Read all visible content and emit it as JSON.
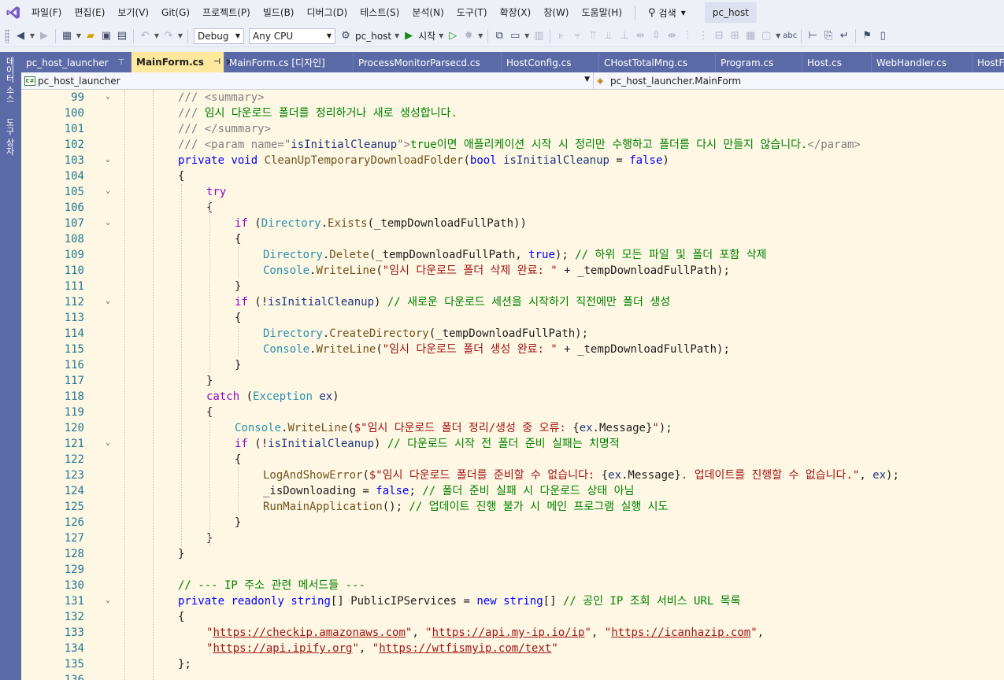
{
  "menubar": {
    "items": [
      "파일(F)",
      "편집(E)",
      "보기(V)",
      "Git(G)",
      "프로젝트(P)",
      "빌드(B)",
      "디버그(D)",
      "테스트(S)",
      "분석(N)",
      "도구(T)",
      "확장(X)",
      "창(W)",
      "도움말(H)"
    ],
    "search_label": "검색",
    "project_name": "pc_host"
  },
  "toolbar": {
    "config": "Debug",
    "platform": "Any CPU",
    "startup_project": "pc_host",
    "start_label": "시작"
  },
  "sidebar": {
    "tab1": "데이터 소스",
    "tab2": "도구 상자"
  },
  "tabs": [
    {
      "label": "pc_host_launcher",
      "pinned": true,
      "active": false
    },
    {
      "label": "MainForm.cs",
      "pinned": true,
      "active": true
    },
    {
      "label": "MainForm.cs [디자인]",
      "active": false
    },
    {
      "label": "ProcessMonitorParsecd.cs",
      "active": false
    },
    {
      "label": "HostConfig.cs",
      "active": false
    },
    {
      "label": "CHostTotalMng.cs",
      "active": false
    },
    {
      "label": "Program.cs",
      "active": false
    },
    {
      "label": "Host.cs",
      "active": false
    },
    {
      "label": "WebHandler.cs",
      "active": false
    },
    {
      "label": "HostF",
      "active": false
    }
  ],
  "navbar": {
    "project": "pc_host_launcher",
    "type": "pc_host_launcher.MainForm"
  },
  "code": {
    "first_line": 99,
    "lines": [
      {
        "n": "99",
        "fold": true,
        "indent": 2,
        "tokens": [
          [
            "xd",
            "/// <summary>"
          ]
        ]
      },
      {
        "n": "100",
        "indent": 2,
        "tokens": [
          [
            "xd",
            "/// "
          ],
          [
            "cm",
            "임시 다운로드 폴더를 정리하거나 새로 생성합니다."
          ]
        ]
      },
      {
        "n": "101",
        "indent": 2,
        "tokens": [
          [
            "xd",
            "/// </summary>"
          ]
        ]
      },
      {
        "n": "102",
        "indent": 2,
        "tokens": [
          [
            "xd",
            "/// <param name=\""
          ],
          [
            "pm",
            "isInitialCleanup"
          ],
          [
            "xd",
            "\">"
          ],
          [
            "cm",
            "true이면 애플리케이션 시작 시 정리만 수행하고 폴더를 다시 만들지 않습니다."
          ],
          [
            "xd",
            "</param>"
          ]
        ]
      },
      {
        "n": "103",
        "fold": true,
        "indent": 2,
        "tokens": [
          [
            "kw",
            "private"
          ],
          [
            "fd",
            " "
          ],
          [
            "kw",
            "void"
          ],
          [
            "fd",
            " "
          ],
          [
            "mt",
            "CleanUpTemporaryDownloadFolder"
          ],
          [
            "fd",
            "("
          ],
          [
            "kw",
            "bool"
          ],
          [
            "fd",
            " "
          ],
          [
            "pm",
            "isInitialCleanup"
          ],
          [
            "fd",
            " = "
          ],
          [
            "kw",
            "false"
          ],
          [
            "fd",
            ")"
          ]
        ]
      },
      {
        "n": "104",
        "indent": 2,
        "tokens": [
          [
            "fd",
            "{"
          ]
        ]
      },
      {
        "n": "105",
        "fold": true,
        "indent": 3,
        "tokens": [
          [
            "ctl",
            "try"
          ]
        ]
      },
      {
        "n": "106",
        "indent": 3,
        "tokens": [
          [
            "fd",
            "{"
          ]
        ]
      },
      {
        "n": "107",
        "fold": true,
        "indent": 4,
        "tokens": [
          [
            "ctl",
            "if"
          ],
          [
            "fd",
            " ("
          ],
          [
            "ty",
            "Directory"
          ],
          [
            "fd",
            "."
          ],
          [
            "mt",
            "Exists"
          ],
          [
            "fd",
            "(_tempDownloadFullPath))"
          ]
        ]
      },
      {
        "n": "108",
        "indent": 4,
        "tokens": [
          [
            "fd",
            "{"
          ]
        ]
      },
      {
        "n": "109",
        "indent": 5,
        "tokens": [
          [
            "ty",
            "Directory"
          ],
          [
            "fd",
            "."
          ],
          [
            "mt",
            "Delete"
          ],
          [
            "fd",
            "(_tempDownloadFullPath, "
          ],
          [
            "kw",
            "true"
          ],
          [
            "fd",
            "); "
          ],
          [
            "cm",
            "// 하위 모든 파일 및 폴더 포함 삭제"
          ]
        ]
      },
      {
        "n": "110",
        "indent": 5,
        "tokens": [
          [
            "ty",
            "Console"
          ],
          [
            "fd",
            "."
          ],
          [
            "mt",
            "WriteLine"
          ],
          [
            "fd",
            "("
          ],
          [
            "st",
            "\"임시 다운로드 폴더 삭제 완료: \""
          ],
          [
            "fd",
            " + _tempDownloadFullPath);"
          ]
        ]
      },
      {
        "n": "111",
        "indent": 4,
        "tokens": [
          [
            "fd",
            "}"
          ]
        ]
      },
      {
        "n": "112",
        "fold": true,
        "indent": 4,
        "tokens": [
          [
            "ctl",
            "if"
          ],
          [
            "fd",
            " (!"
          ],
          [
            "pm",
            "isInitialCleanup"
          ],
          [
            "fd",
            ") "
          ],
          [
            "cm",
            "// 새로운 다운로드 세션을 시작하기 직전에만 폴더 생성"
          ]
        ]
      },
      {
        "n": "113",
        "indent": 4,
        "tokens": [
          [
            "fd",
            "{"
          ]
        ]
      },
      {
        "n": "114",
        "indent": 5,
        "tokens": [
          [
            "ty",
            "Directory"
          ],
          [
            "fd",
            "."
          ],
          [
            "mt",
            "CreateDirectory"
          ],
          [
            "fd",
            "(_tempDownloadFullPath);"
          ]
        ]
      },
      {
        "n": "115",
        "indent": 5,
        "tokens": [
          [
            "ty",
            "Console"
          ],
          [
            "fd",
            "."
          ],
          [
            "mt",
            "WriteLine"
          ],
          [
            "fd",
            "("
          ],
          [
            "st",
            "\"임시 다운로드 폴더 생성 완료: \""
          ],
          [
            "fd",
            " + _tempDownloadFullPath);"
          ]
        ]
      },
      {
        "n": "116",
        "indent": 4,
        "tokens": [
          [
            "fd",
            "}"
          ]
        ]
      },
      {
        "n": "117",
        "indent": 3,
        "tokens": [
          [
            "fd",
            "}"
          ]
        ]
      },
      {
        "n": "118",
        "indent": 3,
        "tokens": [
          [
            "ctl",
            "catch"
          ],
          [
            "fd",
            " ("
          ],
          [
            "ty",
            "Exception"
          ],
          [
            "fd",
            " "
          ],
          [
            "pm",
            "ex"
          ],
          [
            "fd",
            ")"
          ]
        ]
      },
      {
        "n": "119",
        "indent": 3,
        "tokens": [
          [
            "fd",
            "{"
          ]
        ]
      },
      {
        "n": "120",
        "indent": 4,
        "tokens": [
          [
            "ty",
            "Console"
          ],
          [
            "fd",
            "."
          ],
          [
            "mt",
            "WriteLine"
          ],
          [
            "fd",
            "("
          ],
          [
            "st",
            "$\"임시 다운로드 폴더 정리/생성 중 오류: "
          ],
          [
            "fd",
            "{"
          ],
          [
            "pm",
            "ex"
          ],
          [
            "fd",
            ".Message}"
          ],
          [
            "st",
            "\""
          ],
          [
            "fd",
            ");"
          ]
        ]
      },
      {
        "n": "121",
        "fold": true,
        "indent": 4,
        "tokens": [
          [
            "ctl",
            "if"
          ],
          [
            "fd",
            " (!"
          ],
          [
            "pm",
            "isInitialCleanup"
          ],
          [
            "fd",
            ") "
          ],
          [
            "cm",
            "// 다운로드 시작 전 폴더 준비 실패는 치명적"
          ]
        ]
      },
      {
        "n": "122",
        "indent": 4,
        "tokens": [
          [
            "fd",
            "{"
          ]
        ]
      },
      {
        "n": "123",
        "indent": 5,
        "tokens": [
          [
            "mt",
            "LogAndShowError"
          ],
          [
            "fd",
            "("
          ],
          [
            "st",
            "$\"임시 다운로드 폴더를 준비할 수 없습니다: "
          ],
          [
            "fd",
            "{"
          ],
          [
            "pm",
            "ex"
          ],
          [
            "fd",
            ".Message}"
          ],
          [
            "st",
            ". 업데이트를 진행할 수 없습니다.\""
          ],
          [
            "fd",
            ", "
          ],
          [
            "pm",
            "ex"
          ],
          [
            "fd",
            ");"
          ]
        ]
      },
      {
        "n": "124",
        "indent": 5,
        "tokens": [
          [
            "fd",
            "_isDownloading = "
          ],
          [
            "kw",
            "false"
          ],
          [
            "fd",
            "; "
          ],
          [
            "cm",
            "// 폴더 준비 실패 시 다운로드 상태 아님"
          ]
        ]
      },
      {
        "n": "125",
        "indent": 5,
        "tokens": [
          [
            "mt",
            "RunMainApplication"
          ],
          [
            "fd",
            "(); "
          ],
          [
            "cm",
            "// 업데이트 진행 불가 시 메인 프로그램 실행 시도"
          ]
        ]
      },
      {
        "n": "126",
        "indent": 4,
        "tokens": [
          [
            "fd",
            "}"
          ]
        ]
      },
      {
        "n": "127",
        "indent": 3,
        "tokens": [
          [
            "fd",
            "}"
          ]
        ]
      },
      {
        "n": "128",
        "indent": 2,
        "tokens": [
          [
            "fd",
            "}"
          ]
        ]
      },
      {
        "n": "129",
        "indent": 0,
        "tokens": []
      },
      {
        "n": "130",
        "indent": 2,
        "tokens": [
          [
            "cm",
            "// --- IP 주소 관련 메서드들 ---"
          ]
        ]
      },
      {
        "n": "131",
        "fold": true,
        "indent": 2,
        "tokens": [
          [
            "kw",
            "private"
          ],
          [
            "fd",
            " "
          ],
          [
            "kw",
            "readonly"
          ],
          [
            "fd",
            " "
          ],
          [
            "kw",
            "string"
          ],
          [
            "fd",
            "[] PublicIPServices = "
          ],
          [
            "kw",
            "new"
          ],
          [
            "fd",
            " "
          ],
          [
            "kw",
            "string"
          ],
          [
            "fd",
            "[] "
          ],
          [
            "cm",
            "// 공인 IP 조회 서비스 URL 목록"
          ]
        ]
      },
      {
        "n": "132",
        "indent": 2,
        "tokens": [
          [
            "fd",
            "{"
          ]
        ]
      },
      {
        "n": "133",
        "indent": 3,
        "tokens": [
          [
            "st",
            "\""
          ],
          [
            "link",
            "https://checkip.amazonaws.com"
          ],
          [
            "st",
            "\""
          ],
          [
            "fd",
            ", "
          ],
          [
            "st",
            "\""
          ],
          [
            "link",
            "https://api.my-ip.io/ip"
          ],
          [
            "st",
            "\""
          ],
          [
            "fd",
            ", "
          ],
          [
            "st",
            "\""
          ],
          [
            "link",
            "https://icanhazip.com"
          ],
          [
            "st",
            "\""
          ],
          [
            "fd",
            ","
          ]
        ]
      },
      {
        "n": "134",
        "indent": 3,
        "tokens": [
          [
            "st",
            "\""
          ],
          [
            "link",
            "https://api.ipify.org"
          ],
          [
            "st",
            "\""
          ],
          [
            "fd",
            ", "
          ],
          [
            "st",
            "\""
          ],
          [
            "link",
            "https://wtfismyip.com/text"
          ],
          [
            "st",
            "\""
          ]
        ]
      },
      {
        "n": "135",
        "indent": 2,
        "tokens": [
          [
            "fd",
            "};"
          ]
        ]
      },
      {
        "n": "136",
        "indent": 0,
        "tokens": []
      }
    ]
  }
}
